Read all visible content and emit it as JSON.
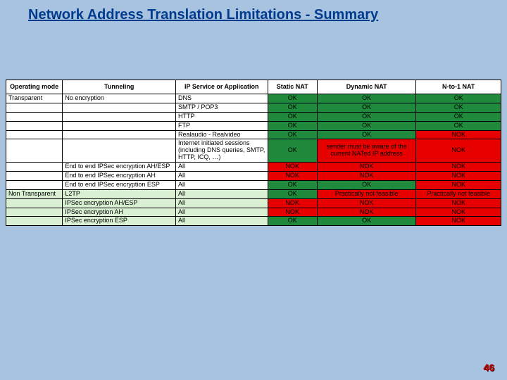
{
  "title": "Network Address Translation Limitations - Summary",
  "pageNumber": "46",
  "headers": {
    "mode": "Operating mode",
    "tun": "Tunneling",
    "svc": "IP Service or Application",
    "stat": "Static NAT",
    "dyn": "Dynamic NAT",
    "nto1": "N-to-1 NAT"
  },
  "rows": [
    {
      "mode": "Transparent",
      "tun": "No encryption",
      "svc": "DNS",
      "s": "OK",
      "d": "OK",
      "n": "OK"
    },
    {
      "mode": "",
      "tun": "",
      "svc": "SMTP / POP3",
      "s": "OK",
      "d": "OK",
      "n": "OK"
    },
    {
      "mode": "",
      "tun": "",
      "svc": "HTTP",
      "s": "OK",
      "d": "OK",
      "n": "OK"
    },
    {
      "mode": "",
      "tun": "",
      "svc": "FTP",
      "s": "OK",
      "d": "OK",
      "n": "OK"
    },
    {
      "mode": "",
      "tun": "",
      "svc": "Realaudio - Realvideo",
      "s": "OK",
      "d": "OK",
      "n": "NOK",
      "nCls": "nok"
    },
    {
      "mode": "",
      "tun": "",
      "svc": "Internet initiated sessions (including DNS queries, SMTP, HTTP, ICQ, …)",
      "s": "OK",
      "d": "sender must be aware of the current NATed IP address",
      "dCls": "warn",
      "n": "NOK",
      "nCls": "nok",
      "tall": true
    },
    {
      "mode": "",
      "tun": "End to end IPSec encryption AH/ESP",
      "svc": "All",
      "s": "NOK",
      "sCls": "nok",
      "d": "NOK",
      "dCls": "nok",
      "n": "NOK",
      "nCls": "nok"
    },
    {
      "mode": "",
      "tun": "End to end IPSec encryption AH",
      "svc": "All",
      "s": "NOK",
      "sCls": "nok",
      "d": "NOK",
      "dCls": "nok",
      "n": "NOK",
      "nCls": "nok"
    },
    {
      "mode": "",
      "tun": "End to end IPSec encryption ESP",
      "svc": "All",
      "s": "OK",
      "d": "OK",
      "n": "NOK",
      "nCls": "nok"
    },
    {
      "mode": "Non Transparent",
      "tun": "L2TP",
      "svc": "All",
      "s": "OK",
      "d": "Practically not feasible",
      "dCls": "warn",
      "n": "Practically not feasible",
      "nCls": "warn",
      "pale": true
    },
    {
      "mode": "",
      "tun": "IPSec encryption AH/ESP",
      "svc": "All",
      "s": "NOK",
      "sCls": "nok",
      "d": "NOK",
      "dCls": "nok",
      "n": "NOK",
      "nCls": "nok",
      "pale": true
    },
    {
      "mode": "",
      "tun": "IPSec encryption AH",
      "svc": "All",
      "s": "NOK",
      "sCls": "nok",
      "d": "NOK",
      "dCls": "nok",
      "n": "NOK",
      "nCls": "nok",
      "pale": true
    },
    {
      "mode": "",
      "tun": "IPSec encryption ESP",
      "svc": "All",
      "s": "OK",
      "d": "OK",
      "n": "NOK",
      "nCls": "nok",
      "pale": true
    }
  ]
}
